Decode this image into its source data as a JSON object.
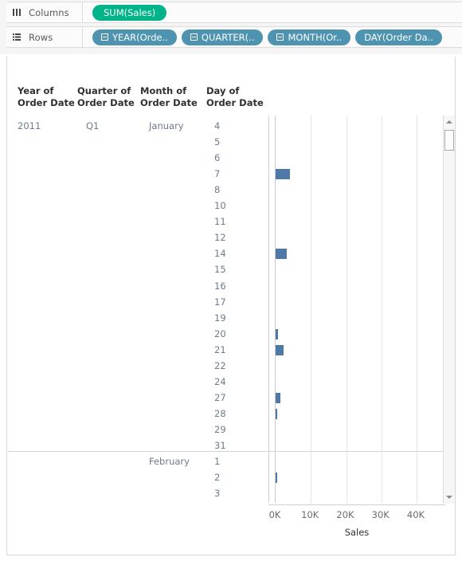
{
  "shelves": {
    "columns": {
      "label": "Columns",
      "icon": "columns-icon",
      "pills": [
        {
          "text": "SUM(Sales)",
          "type": "measure",
          "expandable": false
        }
      ]
    },
    "rows": {
      "label": "Rows",
      "icon": "rows-icon",
      "pills": [
        {
          "text": "YEAR(Orde..",
          "type": "dimension",
          "expandable": true
        },
        {
          "text": "QUARTER(..",
          "type": "dimension",
          "expandable": true
        },
        {
          "text": "MONTH(Or..",
          "type": "dimension",
          "expandable": true
        },
        {
          "text": "DAY(Order Da..",
          "type": "dimension",
          "expandable": false
        }
      ]
    }
  },
  "colors": {
    "measure_pill": "#00b388",
    "dimension_pill": "#4e93b0",
    "bar": "#4e79a7",
    "label_text": "#6d7b8c"
  },
  "table": {
    "headers": [
      "Year of Order Date",
      "Quarter of Order Date",
      "Month of Order Date",
      "Day of Order Date"
    ],
    "rows": [
      {
        "year": "2011",
        "quarter": "Q1",
        "month": "January",
        "day": "4",
        "value": 0,
        "group_start": true
      },
      {
        "year": "",
        "quarter": "",
        "month": "",
        "day": "5",
        "value": 0
      },
      {
        "year": "",
        "quarter": "",
        "month": "",
        "day": "6",
        "value": 0
      },
      {
        "year": "",
        "quarter": "",
        "month": "",
        "day": "7",
        "value": 4050
      },
      {
        "year": "",
        "quarter": "",
        "month": "",
        "day": "8",
        "value": 0
      },
      {
        "year": "",
        "quarter": "",
        "month": "",
        "day": "10",
        "value": 0
      },
      {
        "year": "",
        "quarter": "",
        "month": "",
        "day": "11",
        "value": 0
      },
      {
        "year": "",
        "quarter": "",
        "month": "",
        "day": "12",
        "value": 0
      },
      {
        "year": "",
        "quarter": "",
        "month": "",
        "day": "14",
        "value": 3200
      },
      {
        "year": "",
        "quarter": "",
        "month": "",
        "day": "15",
        "value": 0
      },
      {
        "year": "",
        "quarter": "",
        "month": "",
        "day": "16",
        "value": 0
      },
      {
        "year": "",
        "quarter": "",
        "month": "",
        "day": "17",
        "value": 0
      },
      {
        "year": "",
        "quarter": "",
        "month": "",
        "day": "19",
        "value": 0
      },
      {
        "year": "",
        "quarter": "",
        "month": "",
        "day": "20",
        "value": 620
      },
      {
        "year": "",
        "quarter": "",
        "month": "",
        "day": "21",
        "value": 2150
      },
      {
        "year": "",
        "quarter": "",
        "month": "",
        "day": "22",
        "value": 0
      },
      {
        "year": "",
        "quarter": "",
        "month": "",
        "day": "24",
        "value": 0
      },
      {
        "year": "",
        "quarter": "",
        "month": "",
        "day": "27",
        "value": 1300
      },
      {
        "year": "",
        "quarter": "",
        "month": "",
        "day": "28",
        "value": 280
      },
      {
        "year": "",
        "quarter": "",
        "month": "",
        "day": "29",
        "value": 0
      },
      {
        "year": "",
        "quarter": "",
        "month": "",
        "day": "31",
        "value": 0
      },
      {
        "year": "",
        "quarter": "",
        "month": "February",
        "day": "1",
        "value": 0,
        "group_start": true
      },
      {
        "year": "",
        "quarter": "",
        "month": "",
        "day": "2",
        "value": 260
      },
      {
        "year": "",
        "quarter": "",
        "month": "",
        "day": "3",
        "value": 0
      }
    ]
  },
  "chart_data": {
    "type": "bar",
    "title": "",
    "xlabel": "Sales",
    "ylabel": "",
    "orientation": "horizontal",
    "xlim": [
      0,
      47000
    ],
    "xticks": [
      "0K",
      "10K",
      "20K",
      "30K",
      "40K"
    ],
    "xtick_values": [
      0,
      10000,
      20000,
      30000,
      40000
    ],
    "grid": "vertical",
    "legend": "none",
    "bar_color": "#4e79a7",
    "categories": [
      "2011 / Q1 / January / 4",
      "2011 / Q1 / January / 5",
      "2011 / Q1 / January / 6",
      "2011 / Q1 / January / 7",
      "2011 / Q1 / January / 8",
      "2011 / Q1 / January / 10",
      "2011 / Q1 / January / 11",
      "2011 / Q1 / January / 12",
      "2011 / Q1 / January / 14",
      "2011 / Q1 / January / 15",
      "2011 / Q1 / January / 16",
      "2011 / Q1 / January / 17",
      "2011 / Q1 / January / 19",
      "2011 / Q1 / January / 20",
      "2011 / Q1 / January / 21",
      "2011 / Q1 / January / 22",
      "2011 / Q1 / January / 24",
      "2011 / Q1 / January / 27",
      "2011 / Q1 / January / 28",
      "2011 / Q1 / January / 29",
      "2011 / Q1 / January / 31",
      "2011 / Q1 / February / 1",
      "2011 / Q1 / February / 2",
      "2011 / Q1 / February / 3"
    ],
    "values": [
      0,
      0,
      0,
      4050,
      0,
      0,
      0,
      0,
      3200,
      0,
      0,
      0,
      0,
      620,
      2150,
      0,
      0,
      1300,
      280,
      0,
      0,
      0,
      260,
      0
    ]
  },
  "scrollbar": {
    "up_label": "scroll-up",
    "down_label": "scroll-down",
    "thumb_label": "scroll-thumb"
  }
}
